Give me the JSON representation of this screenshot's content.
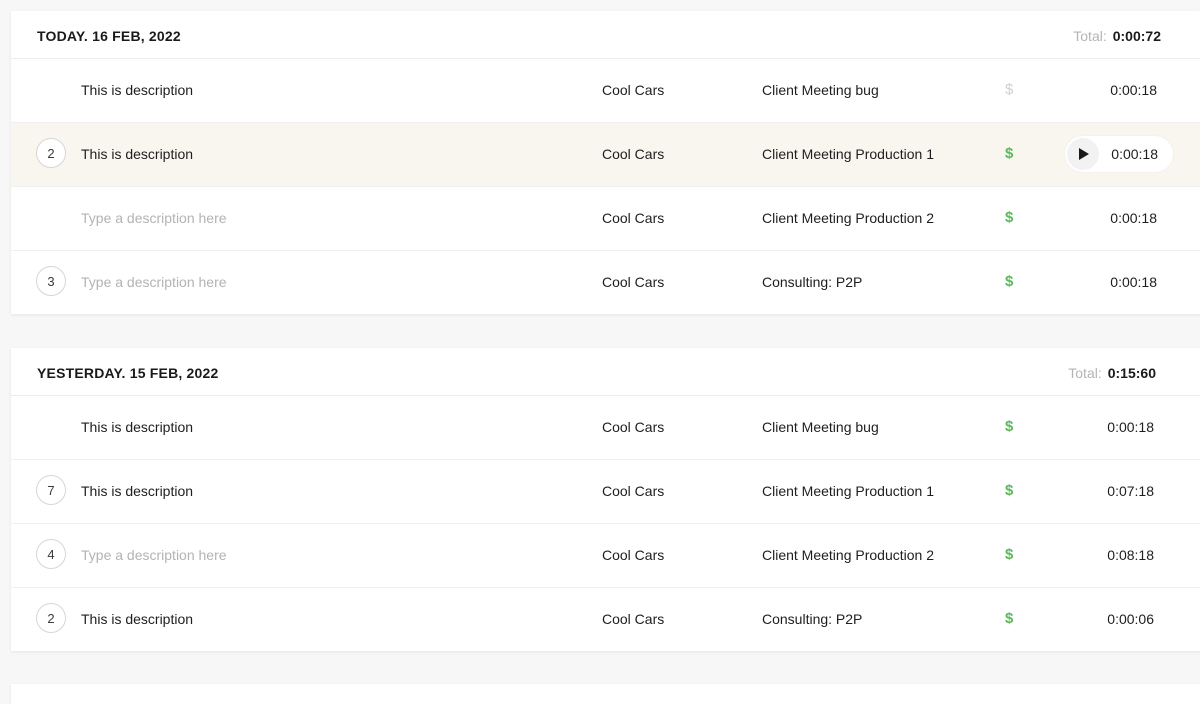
{
  "groups": [
    {
      "date": "TODAY. 16 FEB, 2022",
      "total_label": "Total:",
      "total_value": "0:00:72",
      "rows": [
        {
          "count": "",
          "description": "This is description",
          "placeholder": false,
          "client": "Cool Cars",
          "project": "Client Meeting bug",
          "billable_symbol": "$",
          "billable": false,
          "duration": "0:00:18"
        },
        {
          "count": "2",
          "description": "This is description",
          "placeholder": false,
          "client": "Cool Cars",
          "project": "Client Meeting Production 1",
          "billable_symbol": "$",
          "billable": true,
          "duration": "0:00:18",
          "active": true,
          "play_icon": "play-icon"
        },
        {
          "count": "",
          "description": "Type a description here",
          "placeholder": true,
          "client": "Cool Cars",
          "project": "Client Meeting Production 2",
          "billable_symbol": "$",
          "billable": true,
          "duration": "0:00:18"
        },
        {
          "count": "3",
          "description": "Type a description here",
          "placeholder": true,
          "client": "Cool Cars",
          "project": "Consulting: P2P",
          "billable_symbol": "$",
          "billable": true,
          "duration": "0:00:18"
        }
      ]
    },
    {
      "date": "YESTERDAY. 15 FEB, 2022",
      "total_label": "Total:",
      "total_value": "0:15:60",
      "rows": [
        {
          "count": "",
          "description": "This is description",
          "placeholder": false,
          "client": "Cool Cars",
          "project": "Client Meeting bug",
          "billable_symbol": "$",
          "billable": true,
          "duration": "0:00:18"
        },
        {
          "count": "7",
          "description": "This is description",
          "placeholder": false,
          "client": "Cool Cars",
          "project": "Client Meeting Production 1",
          "billable_symbol": "$",
          "billable": true,
          "duration": "0:07:18"
        },
        {
          "count": "4",
          "description": "Type a description here",
          "placeholder": true,
          "client": "Cool Cars",
          "project": "Client Meeting Production 2",
          "billable_symbol": "$",
          "billable": true,
          "duration": "0:08:18"
        },
        {
          "count": "2",
          "description": "This is description",
          "placeholder": false,
          "client": "Cool Cars",
          "project": "Consulting: P2P",
          "billable_symbol": "$",
          "billable": true,
          "duration": "0:00:06"
        }
      ]
    }
  ],
  "colors": {
    "billable_on": "#5cb85c",
    "billable_off": "#cfcfcf",
    "active_row": "#f8f6ee",
    "placeholder_text": "#b3b3b3"
  }
}
